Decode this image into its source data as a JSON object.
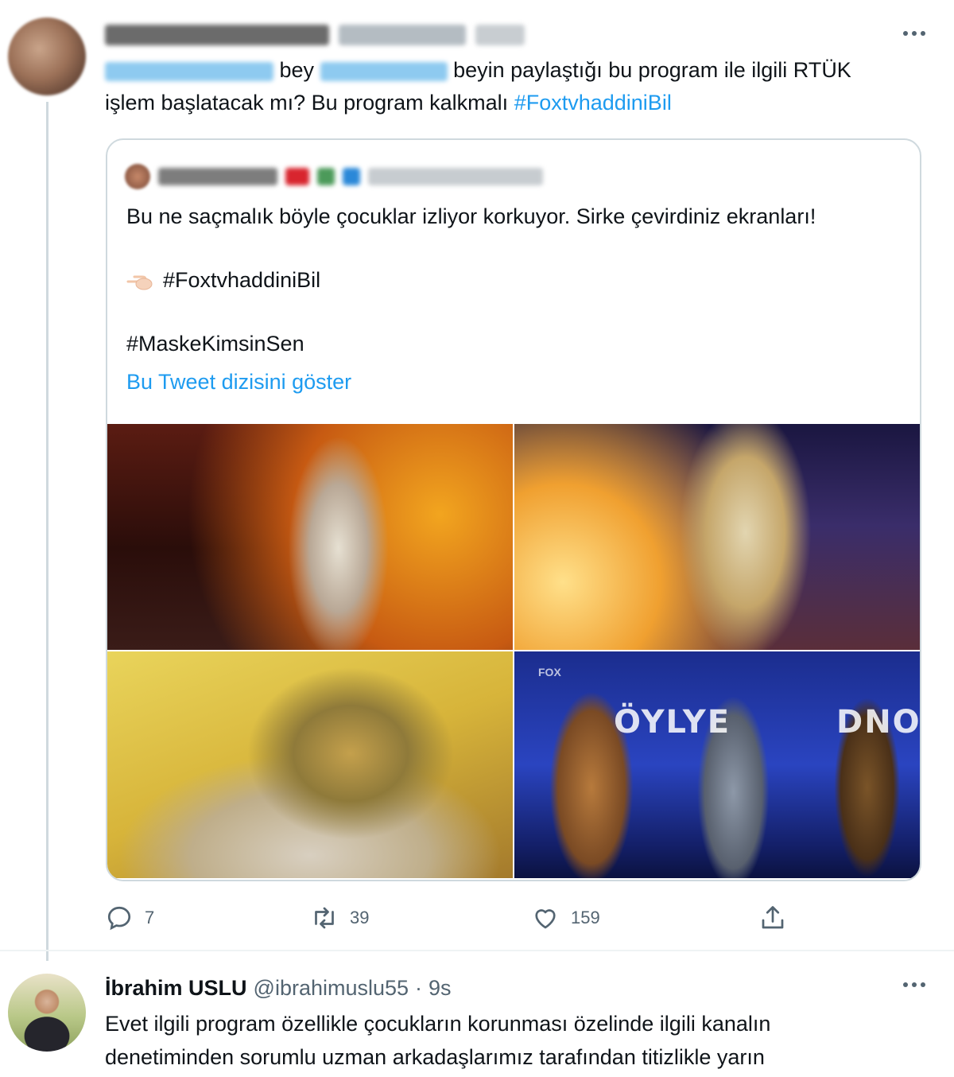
{
  "tweet_1": {
    "text_part_1": "bey",
    "text_part_2": "beyin paylaştığı bu program ile ilgili RTÜK",
    "text_line_2": "işlem başlatacak mı? Bu program kalkmalı",
    "hashtag": "#FoxtvhaddiniBil",
    "quoted": {
      "line_1": "Bu ne saçmalık böyle çocuklar izliyor korkuyor. Sirke çevirdiniz ekranları!",
      "hashtag_1": "#FoxtvhaddiniBil",
      "hashtag_2": "#MaskeKimsinSen",
      "show_thread": "Bu Tweet dizisini göster",
      "media_text": "ÖYLYE",
      "media_text_2": "DNO",
      "media_logo": "FOX"
    },
    "actions": {
      "replies": "7",
      "retweets": "39",
      "likes": "159"
    }
  },
  "tweet_2": {
    "name": "İbrahim USLU",
    "handle": "@ibrahimuslu55",
    "separator": "·",
    "time": "9s",
    "text_line_1": "Evet ilgili program özellikle çocukların korunması özelinde ilgili kanalın",
    "text_line_2": "denetiminden sorumlu uzman arkadaşlarımız tarafından titizlikle yarın"
  },
  "icons": [
    "more-icon",
    "reply-icon",
    "retweet-icon",
    "like-icon",
    "share-icon",
    "pointing-finger-icon"
  ],
  "colors": {
    "link": "#1d9bf0",
    "text": "#0f1419",
    "muted": "#536471",
    "border": "#cfd9de"
  }
}
